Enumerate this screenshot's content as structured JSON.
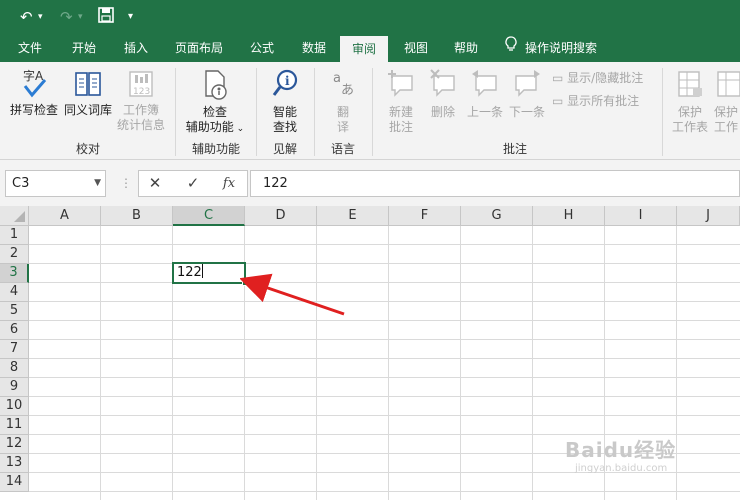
{
  "quick_access": {
    "undo": "↶",
    "redo": "↷",
    "save": "🖫",
    "more": "▾"
  },
  "tabs": [
    "文件",
    "开始",
    "插入",
    "页面布局",
    "公式",
    "数据",
    "审阅",
    "视图",
    "帮助"
  ],
  "active_tab": "审阅",
  "search_tab": "操作说明搜索",
  "ribbon": {
    "spell_check": "拼写检查",
    "thesaurus": "同义词库",
    "workbook_stats_1": "工作簿",
    "workbook_stats_2": "统计信息",
    "group_proofing": "校对",
    "check_1": "检查",
    "check_2": "辅助功能",
    "group_accessibility": "辅助功能",
    "smart_1": "智能",
    "smart_2": "查找",
    "group_insights": "见解",
    "translate_1": "翻",
    "translate_2": "译",
    "group_language": "语言",
    "new_comment_1": "新建",
    "new_comment_2": "批注",
    "delete": "删除",
    "prev": "上一条",
    "next": "下一条",
    "show_hide": "显示/隐藏批注",
    "show_all": "显示所有批注",
    "group_comments": "批注",
    "protect_sheet_1": "保护",
    "protect_sheet_2": "工作表",
    "protect_wb_1": "保护",
    "protect_wb_2": "工作"
  },
  "formula_bar": {
    "name_box": "C3",
    "cancel": "✕",
    "enter": "✓",
    "fx": "fx",
    "value": "122"
  },
  "columns": [
    "A",
    "B",
    "C",
    "D",
    "E",
    "F",
    "G",
    "H",
    "I",
    "J"
  ],
  "rows": [
    "1",
    "2",
    "3",
    "4",
    "5",
    "6",
    "7",
    "8",
    "9",
    "10",
    "11",
    "12",
    "13",
    "14"
  ],
  "active_cell": {
    "ref": "C3",
    "value": "122"
  },
  "accent_color": "#217346",
  "arrow_color": "#e02020",
  "watermark": {
    "text": "Baidu经验",
    "sub": "jingyan.baidu.com"
  }
}
